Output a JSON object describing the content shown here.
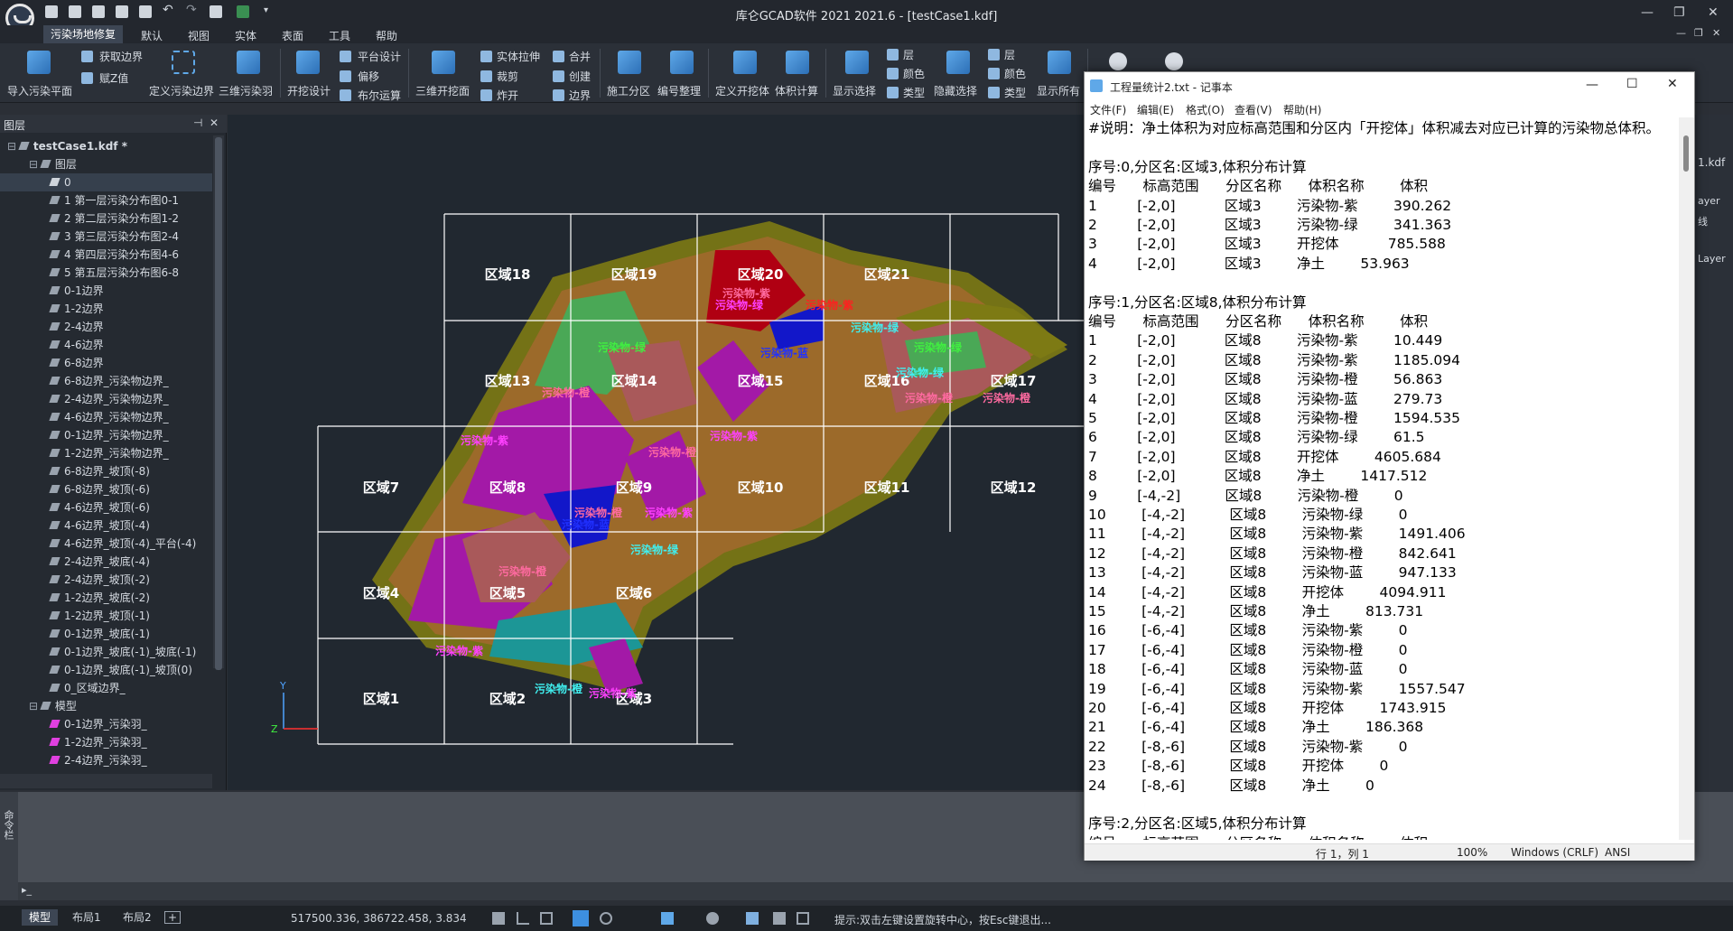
{
  "app": {
    "title": "库仑GCAD软件 2021 2021.6 - [testCase1.kdf]",
    "window_controls": [
      "—",
      "❐",
      "✕"
    ],
    "doc_controls": [
      "—",
      "❐",
      "✕"
    ]
  },
  "menus": [
    "污染场地修复",
    "默认",
    "视图",
    "实体",
    "表面",
    "工具",
    "帮助"
  ],
  "ribbon": {
    "large_buttons": [
      "导入污染平面",
      "定义污染边界",
      "三维污染羽",
      "开挖设计",
      "三维开挖面",
      "施工分区",
      "编号整理",
      "定义开挖体",
      "体积计算",
      "显示选择",
      "隐藏选择",
      "显示所有"
    ],
    "small_buttons": [
      "获取边界",
      "赋Z值",
      "平台设计",
      "偏移",
      "布尔运算",
      "实体拉伸",
      "裁剪",
      "炸开",
      "合并",
      "创建",
      "边界",
      "层",
      "颜色",
      "类型",
      "层",
      "颜色",
      "类型"
    ]
  },
  "left_panel": {
    "title": "图层",
    "tree": [
      {
        "label": "testCase1.kdf *",
        "level": 0,
        "icon": "file-icon"
      },
      {
        "label": "图层",
        "level": 1,
        "icon": "layers-icon"
      },
      {
        "label": "0",
        "level": 2,
        "icon": "check-icon"
      },
      {
        "label": "1 第一层污染分布图0-1",
        "level": 2,
        "icon": "layer-icon"
      },
      {
        "label": "2 第二层污染分布图1-2",
        "level": 2,
        "icon": "layer-icon"
      },
      {
        "label": "3 第三层污染分布图2-4",
        "level": 2,
        "icon": "layer-icon"
      },
      {
        "label": "4 第四层污染分布图4-6",
        "level": 2,
        "icon": "layer-icon"
      },
      {
        "label": "5 第五层污染分布图6-8",
        "level": 2,
        "icon": "layer-icon"
      },
      {
        "label": "0-1边界",
        "level": 2,
        "icon": "layer-icon"
      },
      {
        "label": "1-2边界",
        "level": 2,
        "icon": "layer-icon"
      },
      {
        "label": "2-4边界",
        "level": 2,
        "icon": "layer-icon"
      },
      {
        "label": "4-6边界",
        "level": 2,
        "icon": "layer-icon"
      },
      {
        "label": "6-8边界",
        "level": 2,
        "icon": "layer-icon"
      },
      {
        "label": "6-8边界_污染物边界_",
        "level": 2,
        "icon": "layer-icon"
      },
      {
        "label": "2-4边界_污染物边界_",
        "level": 2,
        "icon": "layer-icon"
      },
      {
        "label": "4-6边界_污染物边界_",
        "level": 2,
        "icon": "layer-icon"
      },
      {
        "label": "0-1边界_污染物边界_",
        "level": 2,
        "icon": "layer-icon"
      },
      {
        "label": "1-2边界_污染物边界_",
        "level": 2,
        "icon": "layer-icon"
      },
      {
        "label": "6-8边界_坡顶(-8)",
        "level": 2,
        "icon": "layer-icon"
      },
      {
        "label": "6-8边界_坡顶(-6)",
        "level": 2,
        "icon": "layer-icon"
      },
      {
        "label": "4-6边界_坡顶(-6)",
        "level": 2,
        "icon": "layer-icon"
      },
      {
        "label": "4-6边界_坡顶(-4)",
        "level": 2,
        "icon": "layer-icon"
      },
      {
        "label": "4-6边界_坡顶(-4)_平台(-4)",
        "level": 2,
        "icon": "layer-icon"
      },
      {
        "label": "2-4边界_坡底(-4)",
        "level": 2,
        "icon": "layer-icon"
      },
      {
        "label": "2-4边界_坡顶(-2)",
        "level": 2,
        "icon": "layer-icon"
      },
      {
        "label": "1-2边界_坡底(-2)",
        "level": 2,
        "icon": "layer-icon"
      },
      {
        "label": "1-2边界_坡顶(-1)",
        "level": 2,
        "icon": "layer-icon"
      },
      {
        "label": "0-1边界_坡底(-1)",
        "level": 2,
        "icon": "layer-icon"
      },
      {
        "label": "0-1边界_坡底(-1)_坡底(-1)",
        "level": 2,
        "icon": "layer-icon"
      },
      {
        "label": "0-1边界_坡底(-1)_坡顶(0)",
        "level": 2,
        "icon": "layer-icon"
      },
      {
        "label": "0_区域边界_",
        "level": 2,
        "icon": "layer-icon"
      },
      {
        "label": "模型",
        "level": 1,
        "icon": "model-icon"
      },
      {
        "label": "0-1边界_污染羽_",
        "level": 2,
        "icon": "solid-icon"
      },
      {
        "label": "1-2边界_污染羽_",
        "level": 2,
        "icon": "solid-icon"
      },
      {
        "label": "2-4边界_污染羽_",
        "level": 2,
        "icon": "solid-icon"
      }
    ]
  },
  "canvas": {
    "zones": [
      "区域18",
      "区域19",
      "区域20",
      "区域21",
      "区域13",
      "区域14",
      "区域15",
      "区域16",
      "区域17",
      "区域7",
      "区域8",
      "区域9",
      "区域10",
      "区域11",
      "区域12",
      "区域4",
      "区域5",
      "区域6",
      "区域1",
      "区域2",
      "区域3"
    ],
    "pollutant_labels": [
      "污染物-紫",
      "污染物-绿",
      "污染物-橙",
      "污染物-蓝"
    ],
    "axis_y": "Y",
    "axis_z": "Z"
  },
  "notepad": {
    "title": "工程量统计2.txt - 记事本",
    "menu": [
      "文件(F)",
      "编辑(E)",
      "格式(O)",
      "查看(V)",
      "帮助(H)"
    ],
    "lines": [
      "#说明：净土体积为对应标高范围和分区内「开挖体」体积减去对应已计算的污染物总体积。",
      "",
      "序号:0,分区名:区域3,体积分布计算",
      "编号      标高范围      分区名称      体积名称        体积",
      "1         [-2,0]           区域3        污染物-紫        390.262",
      "2         [-2,0]           区域3        污染物-绿        341.363",
      "3         [-2,0]           区域3        开挖体           785.588",
      "4         [-2,0]           区域3        净土        53.963",
      "",
      "序号:1,分区名:区域8,体积分布计算",
      "编号      标高范围      分区名称      体积名称        体积",
      "1         [-2,0]           区域8        污染物-紫        10.449",
      "2         [-2,0]           区域8        污染物-紫        1185.094",
      "3         [-2,0]           区域8        污染物-橙        56.863",
      "4         [-2,0]           区域8        污染物-蓝        279.73",
      "5         [-2,0]           区域8        污染物-橙        1594.535",
      "6         [-2,0]           区域8        污染物-绿        61.5",
      "7         [-2,0]           区域8        开挖体        4605.684",
      "8         [-2,0]           区域8        净土        1417.512",
      "9         [-4,-2]          区域8        污染物-橙        0",
      "10        [-4,-2]          区域8        污染物-绿        0",
      "11        [-4,-2]          区域8        污染物-紫        1491.406",
      "12        [-4,-2]          区域8        污染物-橙        842.641",
      "13        [-4,-2]          区域8        污染物-蓝        947.133",
      "14        [-4,-2]          区域8        开挖体        4094.911",
      "15        [-4,-2]          区域8        净土        813.731",
      "16        [-6,-4]          区域8        污染物-紫        0",
      "17        [-6,-4]          区域8        污染物-橙        0",
      "18        [-6,-4]          区域8        污染物-蓝        0",
      "19        [-6,-4]          区域8        污染物-紫        1557.547",
      "20        [-6,-4]          区域8        开挖体        1743.915",
      "21        [-6,-4]          区域8        净土        186.368",
      "22        [-8,-6]          区域8        污染物-紫        0",
      "23        [-8,-6]          区域8        开挖体        0",
      "24        [-8,-6]          区域8        净土        0",
      "",
      "序号:2,分区名:区域5,体积分布计算",
      "编号      标高范围      分区名称      体积名称        体积"
    ],
    "status": {
      "position": "行 1，列 1",
      "zoom": "100%",
      "eol": "Windows (CRLF)",
      "encoding": "ANSI"
    }
  },
  "statusbar": {
    "tabs": [
      "模型",
      "布局1",
      "布局2"
    ],
    "coords": "517500.336, 386722.458, 3.834",
    "hint": "提示:双击左键设置旋转中心，按Esc键退出..."
  },
  "right_panel_fragments": [
    "1.kdf",
    "ayer",
    "线",
    "Layer"
  ],
  "cmd_label": "命令栏"
}
